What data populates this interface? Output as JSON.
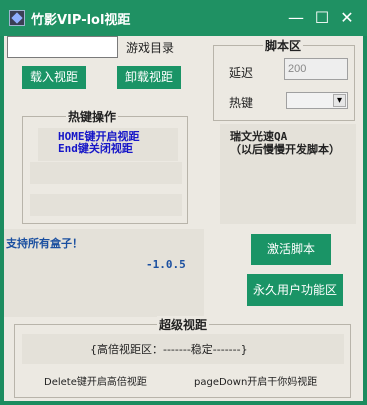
{
  "window": {
    "title": "竹影VIP-lol视距",
    "minimize_icon": "—",
    "maximize_icon": "☐",
    "close_icon": "✕"
  },
  "top": {
    "input_value": "",
    "game_dir_label": "游戏目录",
    "load_button": "载入视距",
    "unload_button": "卸载视距"
  },
  "hotkey_group": {
    "title": "热键操作",
    "line1": "HOME键开启视距",
    "line2": "End键关闭视距",
    "field1_value": "",
    "field2_value": ""
  },
  "script_group": {
    "title": "脚本区",
    "delay_label": "延迟",
    "delay_value": "200",
    "hotkey_label": "热键",
    "hotkey_value": "",
    "dropdown_icon": "▾"
  },
  "info": {
    "line1": "瑞文光速QA",
    "line2": "（以后慢慢开发脚本）"
  },
  "support": {
    "text": "支持所有盒子！",
    "version": "-1.0.5"
  },
  "buttons": {
    "activate": "激活脚本",
    "permanent": "永久用户功能区"
  },
  "super_group": {
    "title": "超级视距",
    "status": "{高倍视距区：-------稳定-------}",
    "delete_hint": "Delete键开启高倍视距",
    "pagedown_hint": "pageDown开启干你妈视距"
  },
  "colors": {
    "titlebar": "#1f9163",
    "button": "#1a9466",
    "body": "#ece9e2",
    "blue_text": "#1616c8",
    "support_text": "#1a4fa0"
  }
}
